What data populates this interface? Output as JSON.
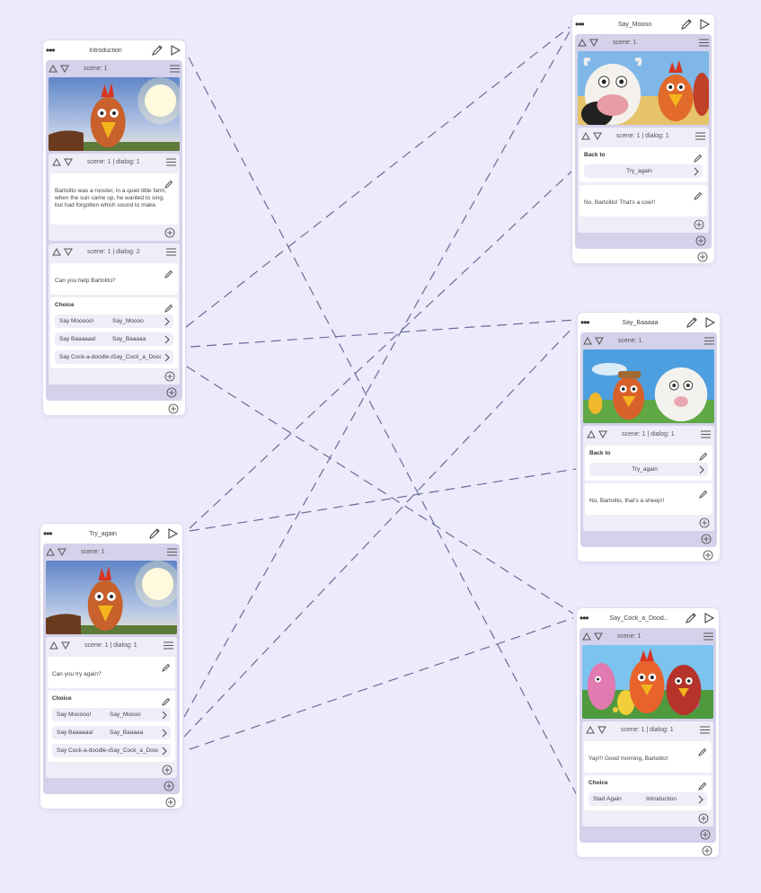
{
  "icons": {
    "menu": "more-dots-icon",
    "edit": "pencil-icon",
    "play": "play-icon",
    "add": "plus-circle-icon",
    "next": "chevron-right-icon",
    "up": "triangle-up-icon",
    "down": "triangle-down-icon",
    "list": "hamburger-icon"
  },
  "colors": {
    "background": "#ecebfb",
    "scene_bg": "#d4d1ea",
    "dialog_bg": "#eeedf8",
    "link": "#6c6a98"
  },
  "nodes": {
    "introduction": {
      "title": "Introduction",
      "scene_label": "scene: 1",
      "dialogs": [
        {
          "label": "scene: 1 | dialog: 1",
          "text": "Bartolito was a rooster, in a quiet little farm, when the sun came up, he wanted to sing, but had forgotten which sound to make."
        },
        {
          "label": "scene: 1 | dialog: 2",
          "text": "Can you help Bartolito?",
          "choice_title": "Choice",
          "choices": [
            {
              "label": "Say Mooooo!",
              "target": "Say_Moooo"
            },
            {
              "label": "Say Baaaaaa!",
              "target": "Say_Baaaaa"
            },
            {
              "label": "Say Cock-a-doodle-doo!",
              "target": "Say_Cock_a_Doodle"
            }
          ]
        }
      ]
    },
    "say_moooo": {
      "title": "Say_Moooo",
      "scene_label": "scene: 1",
      "dialog_label": "scene: 1 | dialog: 1",
      "back_title": "Back to",
      "back_target": "Try_again",
      "text": "No, Bartolito! That's a cow!!"
    },
    "say_baaaaa": {
      "title": "Say_Baaaaa",
      "scene_label": "scene: 1",
      "dialog_label": "scene: 1 | dialog: 1",
      "back_title": "Back to",
      "back_target": "Try_again",
      "text": "No, Bartolito, that's a sheep!!"
    },
    "try_again": {
      "title": "Try_again",
      "scene_label": "scene: 1",
      "dialog_label": "scene: 1 | dialog: 1",
      "text": "Can you try again?",
      "choice_title": "Choice",
      "choices": [
        {
          "label": "Say Mooooo!",
          "target": "Say_Moooo"
        },
        {
          "label": "Say Baaaaaa!",
          "target": "Say_Baaaaa"
        },
        {
          "label": "Say Cock-a-doodle-doo!",
          "target": "Say_Cock_a_Doodle"
        }
      ]
    },
    "say_cock": {
      "title": "Say_Cock_a_Dood...",
      "scene_label": "scene: 1",
      "dialog_label": "scene: 1 | dialog: 1",
      "text": "Yay!!! Good morning, Bartolito!",
      "choice_title": "Choice",
      "choices": [
        {
          "label": "Start Again",
          "target": "Introduction"
        }
      ]
    }
  }
}
